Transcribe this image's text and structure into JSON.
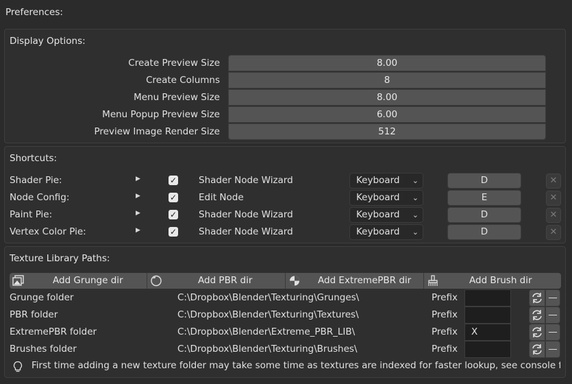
{
  "header": {
    "title": "Preferences:"
  },
  "display": {
    "title": "Display Options:",
    "rows": [
      {
        "label": "Create Preview Size",
        "value": "8.00"
      },
      {
        "label": "Create Columns",
        "value": "8"
      },
      {
        "label": "Menu Preview Size",
        "value": "8.00"
      },
      {
        "label": "Menu Popup Preview Size",
        "value": "6.00"
      },
      {
        "label": "Preview Image Render Size",
        "value": "512"
      }
    ]
  },
  "shortcuts": {
    "title": "Shortcuts:",
    "rows": [
      {
        "name": "Shader Pie:",
        "operator": "Shader Node Wizard",
        "input": "Keyboard",
        "key": "D",
        "enabled": true
      },
      {
        "name": "Node Config:",
        "operator": "Edit Node",
        "input": "Keyboard",
        "key": "E",
        "enabled": true
      },
      {
        "name": "Paint Pie:",
        "operator": "Shader Node Wizard",
        "input": "Keyboard",
        "key": "D",
        "enabled": true
      },
      {
        "name": "Vertex Color Pie:",
        "operator": "Shader Node Wizard",
        "input": "Keyboard",
        "key": "D",
        "enabled": true
      }
    ]
  },
  "texture": {
    "title": "Texture Library Paths:",
    "buttons": [
      {
        "label": "Add Grunge dir",
        "icon": "image-icon"
      },
      {
        "label": "Add PBR dir",
        "icon": "sphere-icon"
      },
      {
        "label": "Add ExtremePBR dir",
        "icon": "shaded-sphere-icon"
      },
      {
        "label": "Add Brush dir",
        "icon": "brush-icon"
      }
    ],
    "prefix_label": "Prefix",
    "rows": [
      {
        "name": "Grunge folder",
        "path": "C:\\Dropbox\\Blender\\Texturing\\Grunges\\",
        "prefix": ""
      },
      {
        "name": "PBR folder",
        "path": "C:\\Dropbox\\Blender\\Texturing\\Textures\\",
        "prefix": ""
      },
      {
        "name": "ExtremePBR folder",
        "path": "C:\\Dropbox\\Blender\\Extreme_PBR_LIB\\",
        "prefix": "X"
      },
      {
        "name": "Brushes folder",
        "path": "C:\\Dropbox\\Blender\\Texturing\\Brushes\\",
        "prefix": ""
      }
    ],
    "info": "First time adding a new texture folder may take some time as textures are indexed for faster lookup, see console for p..."
  }
}
